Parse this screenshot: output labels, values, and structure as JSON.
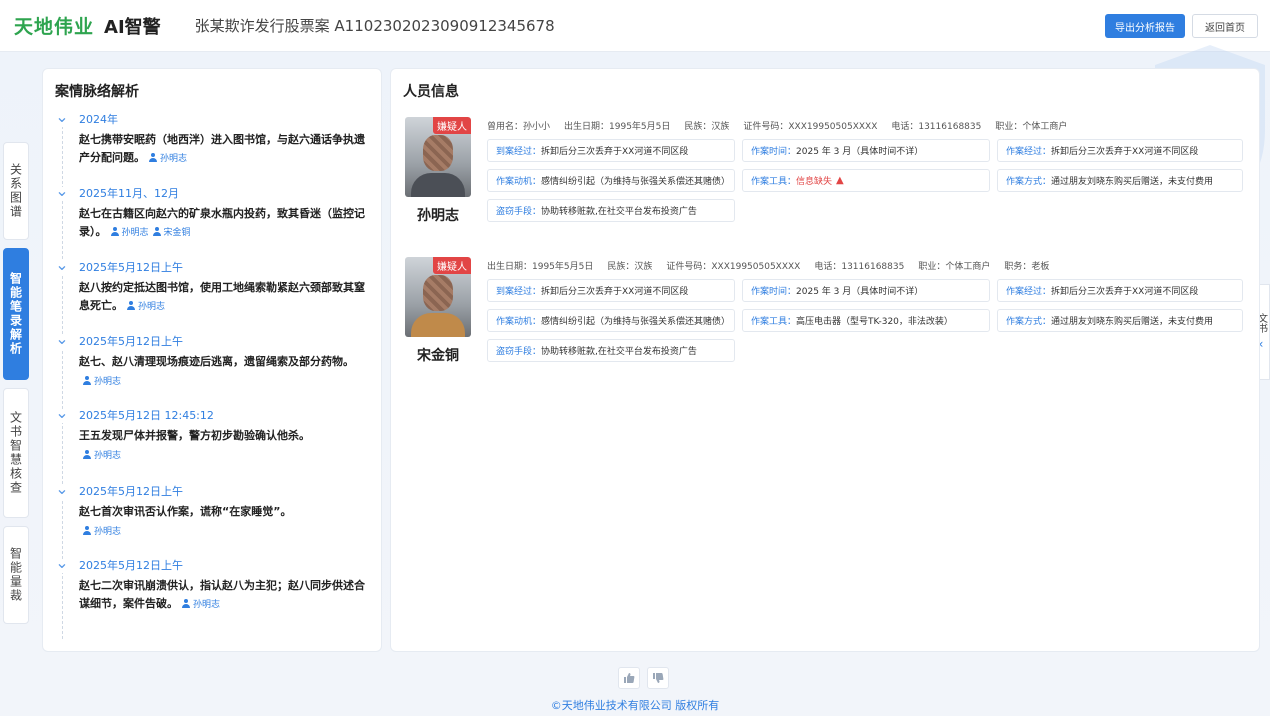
{
  "header": {
    "brand": "天地伟业",
    "product": "AI智警",
    "case_title": "张某欺诈发行股票案 A1102302023090912345678",
    "export_label": "导出分析报告",
    "home_label": "返回首页"
  },
  "side_tabs": [
    "关系图谱",
    "智能笔录解析",
    "文书智慧核查",
    "智能量裁"
  ],
  "right_tab": {
    "label": "文书"
  },
  "timeline_panel": {
    "title": "案情脉络解析",
    "items": [
      {
        "date": "2024年",
        "text": "赵七携带安眠药（地西泮）进入图书馆，与赵六通话争执遗产分配问题。",
        "persons": [
          "孙明志"
        ]
      },
      {
        "date": "2025年11月、12月",
        "text": "赵七在古籍区向赵六的矿泉水瓶内投药，致其昏迷（监控记录）。",
        "persons": [
          "孙明志",
          "宋金铜"
        ]
      },
      {
        "date": "2025年5月12日上午",
        "text": "赵八按约定抵达图书馆，使用工地绳索勒紧赵六颈部致其窒息死亡。",
        "persons": [
          "孙明志"
        ]
      },
      {
        "date": "2025年5月12日上午",
        "text": "赵七、赵八清理现场痕迹后逃离，遗留绳索及部分药物。",
        "persons": [
          "孙明志"
        ]
      },
      {
        "date": "2025年5月12日  12:45:12",
        "text": "王五发现尸体并报警，警方初步勘验确认他杀。",
        "persons": [
          "孙明志"
        ]
      },
      {
        "date": "2025年5月12日上午",
        "text": "赵七首次审讯否认作案，谎称“在家睡觉”。",
        "persons": [
          "孙明志"
        ]
      },
      {
        "date": "2025年5月12日上午",
        "text": "赵七二次审讯崩溃供认，指认赵八为主犯；赵八同步供述合谋细节，案件告破。",
        "persons": [
          "孙明志"
        ]
      }
    ]
  },
  "person_panel": {
    "title": "人员信息",
    "persons": [
      {
        "badge": "嫌疑人",
        "name": "孙明志",
        "meta": [
          "曾用名：孙小小",
          "出生日期：1995年5月5日",
          "民族：汉族",
          "证件号码：XXX19950505XXXX",
          "电话：13116168835",
          "职业：个体工商户"
        ],
        "fields": [
          {
            "k": "到案经过：",
            "v": "拆卸后分三次丢弃于XX河道不同区段"
          },
          {
            "k": "作案时间：",
            "v": "2025 年 3 月（具体时间不详）"
          },
          {
            "k": "作案经过：",
            "v": "拆卸后分三次丢弃于XX河道不同区段"
          },
          {
            "k": "作案动机：",
            "v": "感情纠纷引起（为维持与张强关系偿还其赌债）"
          },
          {
            "k": "作案工具：",
            "v": "信息缺失",
            "warn": true
          },
          {
            "k": "作案方式：",
            "v": "通过朋友刘晓东购买后赠送，未支付费用"
          },
          {
            "k": "盗窃手段：",
            "v": "协助转移赃款,在社交平台发布投资广告"
          }
        ]
      },
      {
        "badge": "嫌疑人",
        "name": "宋金铜",
        "meta": [
          "出生日期：1995年5月5日",
          "民族：汉族",
          "证件号码：XXX19950505XXXX",
          "电话：13116168835",
          "职业：个体工商户",
          "职务：老板"
        ],
        "fields": [
          {
            "k": "到案经过：",
            "v": "拆卸后分三次丢弃于XX河道不同区段"
          },
          {
            "k": "作案时间：",
            "v": "2025 年 3 月（具体时间不详）"
          },
          {
            "k": "作案经过：",
            "v": "拆卸后分三次丢弃于XX河道不同区段"
          },
          {
            "k": "作案动机：",
            "v": "感情纠纷引起（为维持与张强关系偿还其赌债）"
          },
          {
            "k": "作案工具：",
            "v": "高压电击器（型号TK-320，非法改装）"
          },
          {
            "k": "作案方式：",
            "v": "通过朋友刘晓东购买后赠送，未支付费用"
          },
          {
            "k": "盗窃手段：",
            "v": "协助转移赃款,在社交平台发布投资广告"
          }
        ]
      }
    ]
  },
  "footer": {
    "copyright": "©天地伟业技术有限公司 版权所有"
  },
  "colors": {
    "accent": "#2f7ee0",
    "brand": "#2ea44f",
    "danger": "#e24545"
  }
}
